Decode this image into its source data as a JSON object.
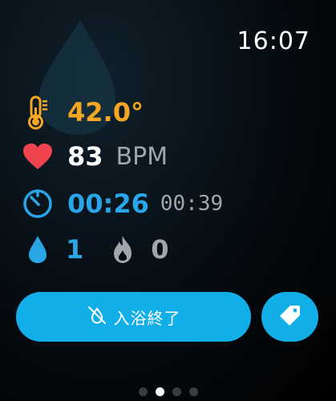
{
  "status": {
    "time": "16:07"
  },
  "temperature": {
    "value": "42.0°",
    "icon": "thermometer-icon"
  },
  "heart_rate": {
    "value": "83",
    "unit": "BPM",
    "icon": "heart-icon"
  },
  "timer": {
    "elapsed": "00:26",
    "secondary": "00:39",
    "icon": "timer-icon"
  },
  "counts": {
    "water": "1",
    "fire": "0"
  },
  "actions": {
    "end_bath_label": "入浴終了",
    "tag_icon": "tag-icon"
  },
  "pager": {
    "total": 4,
    "active": 1
  },
  "colors": {
    "accent": "#12aee8",
    "temperature": "#f5a623",
    "heart": "#f0444f",
    "timer": "#2aa6e8"
  }
}
